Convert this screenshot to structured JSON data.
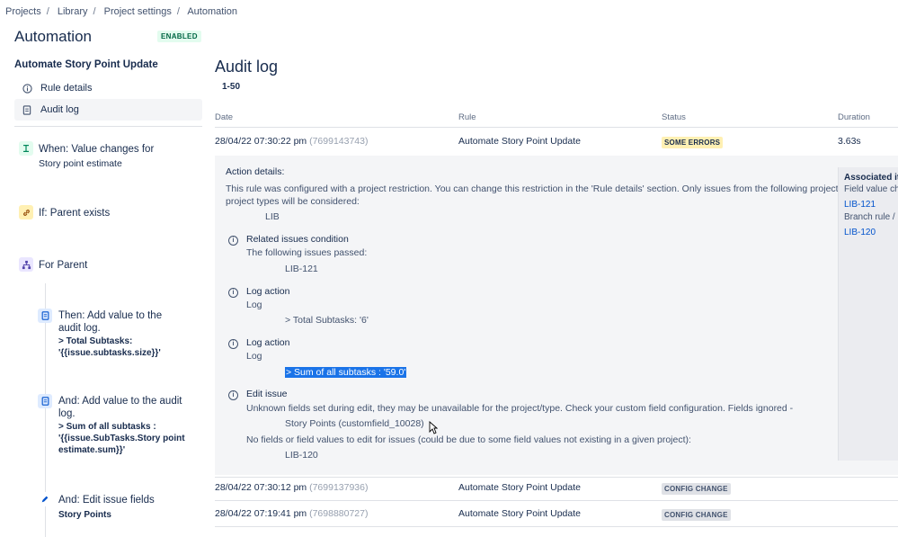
{
  "breadcrumb": [
    "Projects",
    "Library",
    "Project settings",
    "Automation"
  ],
  "page_title": "Automation",
  "status_badge": "ENABLED",
  "sidebar": {
    "rule_name": "Automate Story Point Update",
    "nav": [
      {
        "label": "Rule details",
        "icon": "info-icon"
      },
      {
        "label": "Audit log",
        "icon": "document-icon"
      }
    ],
    "steps": {
      "trigger_title": "When: Value changes for",
      "trigger_sub": "Story point estimate",
      "condition_title": "If: Parent exists",
      "branch_title": "For Parent",
      "then_title_1": "Then: Add value to the",
      "then_title_2": "audit log.",
      "then_bold_1": "> Total Subtasks:",
      "then_bold_2": "'{{issue.subtasks.size}}'",
      "and1_title_1": "And: Add value to the audit",
      "and1_title_2": "log.",
      "and1_bold_1": "> Sum of all subtasks :",
      "and1_bold_2": "'{{issue.SubTasks.Story point",
      "and1_bold_3": "estimate.sum}}'",
      "and2_title": "And: Edit issue fields",
      "and2_bold": "Story Points"
    }
  },
  "audit": {
    "title": "Audit log",
    "range": "1-50",
    "columns": {
      "date": "Date",
      "rule": "Rule",
      "status": "Status",
      "duration": "Duration"
    },
    "rows": [
      {
        "date": "28/04/22 07:30:22 pm",
        "id": "(7699143743)",
        "rule": "Automate Story Point Update",
        "status": "SOME ERRORS",
        "duration": "3.63s"
      },
      {
        "date": "28/04/22 07:30:12 pm",
        "id": "(7699137936)",
        "rule": "Automate Story Point Update",
        "status": "CONFIG CHANGE",
        "duration": ""
      },
      {
        "date": "28/04/22 07:19:41 pm",
        "id": "(7698880727)",
        "rule": "Automate Story Point Update",
        "status": "CONFIG CHANGE",
        "duration": ""
      }
    ],
    "details": {
      "heading": "Action details:",
      "restriction_1": "This rule was configured with a project restriction. You can change this restriction in the 'Rule details' section. Only issues from the following projects or",
      "restriction_2": "project types will be considered:",
      "project": "LIB",
      "related_title": "Related issues condition",
      "related_sub": "The following issues passed:",
      "related_issue": "LIB-121",
      "log1_title": "Log action",
      "log1_sub": "Log",
      "log1_value": "> Total Subtasks: '6'",
      "log2_title": "Log action",
      "log2_sub": "Log",
      "log2_value": "> Sum of all subtasks : '59.0'",
      "edit_title": "Edit issue",
      "edit_warning": "Unknown fields set during edit, they may be unavailable for the project/type. Check your custom field configuration. Fields ignored -",
      "edit_field": "Story Points (customfield_10028)",
      "edit_nofields": "No fields or field values to edit for issues (could be due to some field values not existing in a given project):",
      "edit_issue": "LIB-120"
    },
    "associated": {
      "title": "Associated ite",
      "line1": "Field value cha",
      "link1": "LIB-121",
      "line2": "Branch rule / r",
      "link2": "LIB-120"
    }
  }
}
